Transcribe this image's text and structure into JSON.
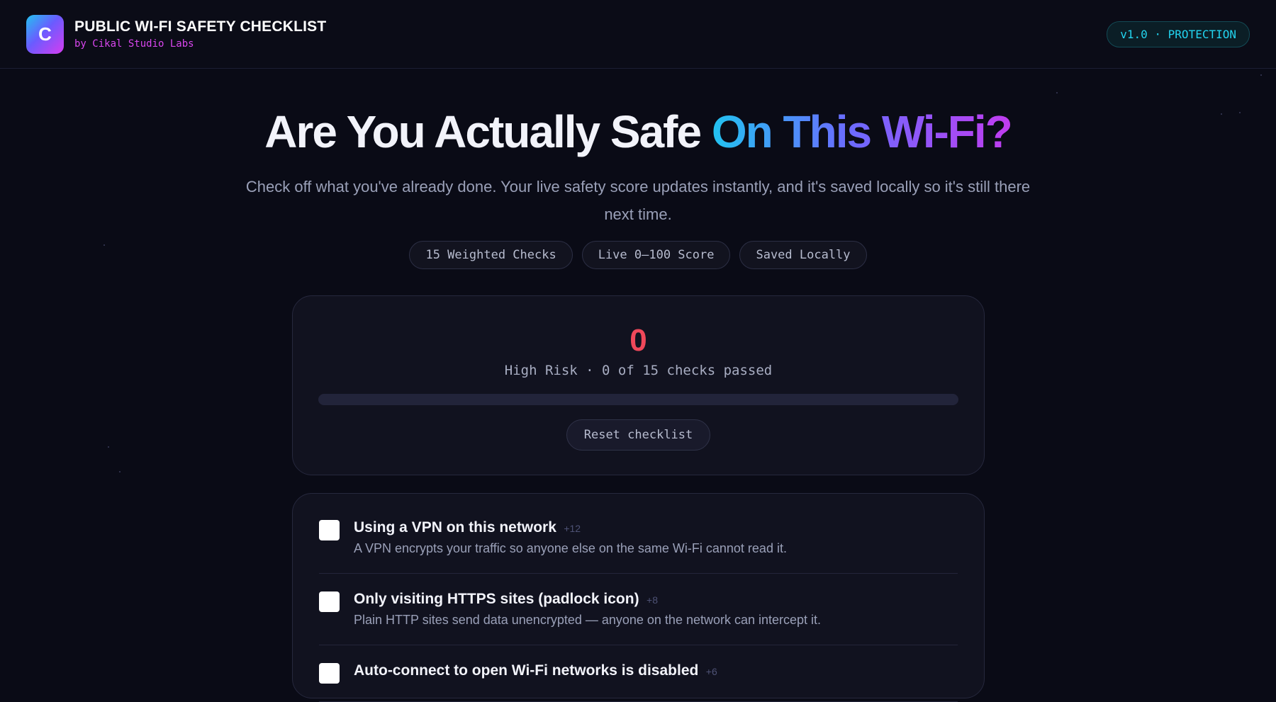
{
  "header": {
    "logo_letter": "C",
    "title": "PUBLIC WI-FI SAFETY CHECKLIST",
    "subtitle": "by Cikal Studio Labs",
    "version": "v1.0 · PROTECTION"
  },
  "hero": {
    "title_plain": "Are You Actually Safe",
    "title_gradient": "On This Wi-Fi?",
    "description": "Check off what you've already done. Your live safety score updates instantly, and it's saved locally so it's still there next time.",
    "chips": [
      "15 Weighted Checks",
      "Live 0–100 Score",
      "Saved Locally"
    ]
  },
  "score": {
    "value": "0",
    "status": "High Risk · 0 of 15 checks passed",
    "progress_percent": 0,
    "color": "#f0485a",
    "reset_label": "Reset checklist"
  },
  "checklist": [
    {
      "title": "Using a VPN on this network",
      "points": "+12",
      "description": "A VPN encrypts your traffic so anyone else on the same Wi-Fi cannot read it.",
      "checked": false
    },
    {
      "title": "Only visiting HTTPS sites (padlock icon)",
      "points": "+8",
      "description": "Plain HTTP sites send data unencrypted — anyone on the network can intercept it.",
      "checked": false
    },
    {
      "title": "Auto-connect to open Wi-Fi networks is disabled",
      "points": "+6",
      "description": "",
      "checked": false
    }
  ],
  "colors": {
    "background": "#0a0b16",
    "accent_cyan": "#22d3ee",
    "accent_magenta": "#d946ef",
    "risk_red": "#f0485a"
  }
}
